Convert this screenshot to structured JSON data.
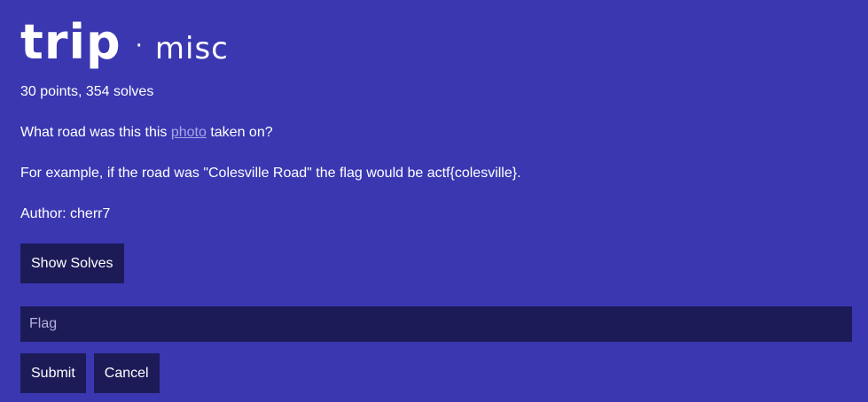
{
  "challenge": {
    "name": "trip",
    "separator": "·",
    "category": "misc",
    "meta": "30 points, 354 solves"
  },
  "description": {
    "question_prefix": "What road was this this ",
    "link_text": "photo",
    "question_suffix": " taken on?",
    "example": "For example, if the road was \"Colesville Road\" the flag would be actf{colesville}.",
    "author": "Author: cherr7"
  },
  "buttons": {
    "show_solves": "Show Solves",
    "submit": "Submit",
    "cancel": "Cancel"
  },
  "flag_input": {
    "placeholder": "Flag",
    "value": ""
  },
  "colors": {
    "background": "#3a37b1",
    "panel": "#1c1b58",
    "link": "#a9a6e8"
  }
}
